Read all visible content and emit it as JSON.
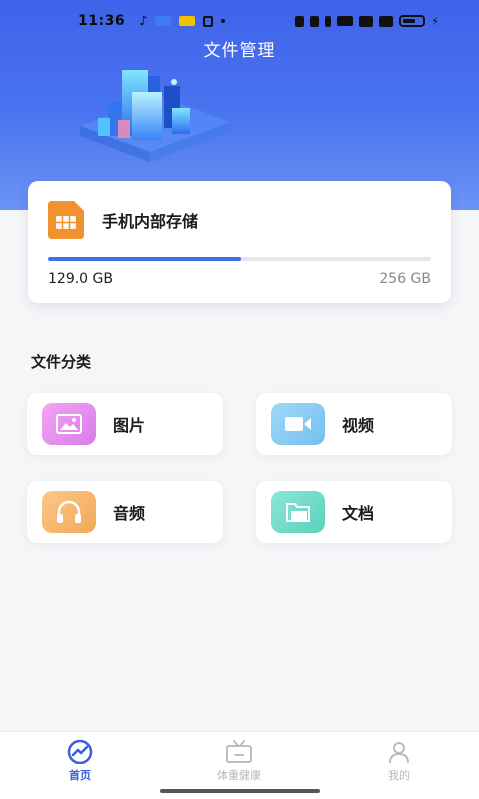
{
  "status_bar": {
    "time": "11:36"
  },
  "header": {
    "title": "文件管理"
  },
  "storage": {
    "name": "手机内部存储",
    "used": "129.0 GB",
    "total": "256 GB",
    "used_fraction": 0.504
  },
  "categories": {
    "title": "文件分类",
    "items": [
      {
        "label": "图片",
        "icon": "image-icon"
      },
      {
        "label": "视频",
        "icon": "video-icon"
      },
      {
        "label": "音频",
        "icon": "headphones-icon"
      },
      {
        "label": "文档",
        "icon": "folder-icon"
      }
    ]
  },
  "tabbar": {
    "tabs": [
      {
        "label": "首页",
        "icon": "home-chart-icon",
        "active": true
      },
      {
        "label": "体重健康",
        "icon": "tv-icon",
        "active": false
      },
      {
        "label": "我的",
        "icon": "user-icon",
        "active": false
      }
    ]
  },
  "colors": {
    "accent": "#3f6fe6",
    "hero_top": "#3f63ea",
    "storage_icon": "#f0922e"
  }
}
